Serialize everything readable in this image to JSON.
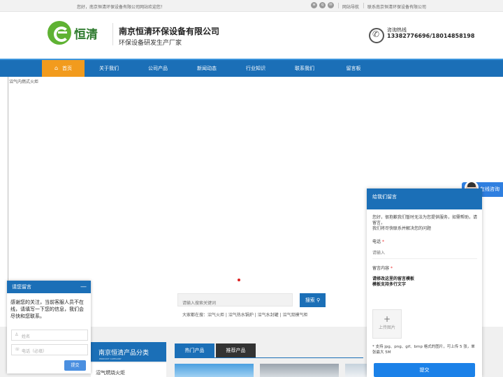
{
  "topbar": {
    "welcome": "您好，南京恒清环保设备有限公司网站欢迎您！",
    "icons": [
      "weibo-icon",
      "qq-icon",
      "wechat-icon"
    ],
    "links": [
      "网站导航",
      "联系南京恒清环保设备有限公司"
    ]
  },
  "header": {
    "logo_text": "恒清",
    "company_name": "南京恒清环保设备有限公司",
    "slogan": "环保设备研发生产厂家",
    "hotline_label": "咨询热线",
    "hotline_number": "13382776696/18014858198"
  },
  "nav": {
    "items": [
      "首页",
      "关于我们",
      "公司产品",
      "新闻动态",
      "行业知识",
      "联系我们",
      "留言板"
    ],
    "active_index": 0
  },
  "banner": {
    "alt": "沼气内燃式火炬"
  },
  "search": {
    "placeholder": "请输入搜索关键词",
    "button": "搜索",
    "hint": "大家都在搜：沼气火炬  |  沼气热水锅炉  |  沼气水封罐  |  沼气双模气柜"
  },
  "products": {
    "category_title": "南京恒清产品分类",
    "category_subtitle": "PRODUCT CATEGORY",
    "first_category": "沼气燃烧火炬",
    "tabs": [
      "热门产品",
      "推荐产品"
    ]
  },
  "chat_left": {
    "title": "请您留言",
    "minimize": "—",
    "message": "感谢您的关注，当前客服人员不在线，请填写一下您的信息，我们会尽快和您联系。",
    "name_placeholder": "姓名",
    "phone_placeholder": "电话（必填）",
    "submit": "提交"
  },
  "chat_right": {
    "title": "给我们留言",
    "intro": "您好，很抱歉我们暂时无法为您提供服务，如需帮助，请留言，\n我们将尽快联系并解决您的问题",
    "phone_label": "电话",
    "phone_placeholder": "请输入",
    "content_label": "留言内容",
    "content_value": "请修改这里的留言模板\n模板支持多行文字",
    "upload_label": "上传图片",
    "upload_note": "* 支持 jpg、png、gif、bmp 格式的图片，可上传 5 张，单张最大 5M",
    "submit": "提交"
  },
  "online_badge": {
    "label": "在线咨询"
  },
  "colors": {
    "brand_blue": "#1b6fb7",
    "accent_orange": "#f29b1d",
    "logo_green": "#5fb233"
  }
}
